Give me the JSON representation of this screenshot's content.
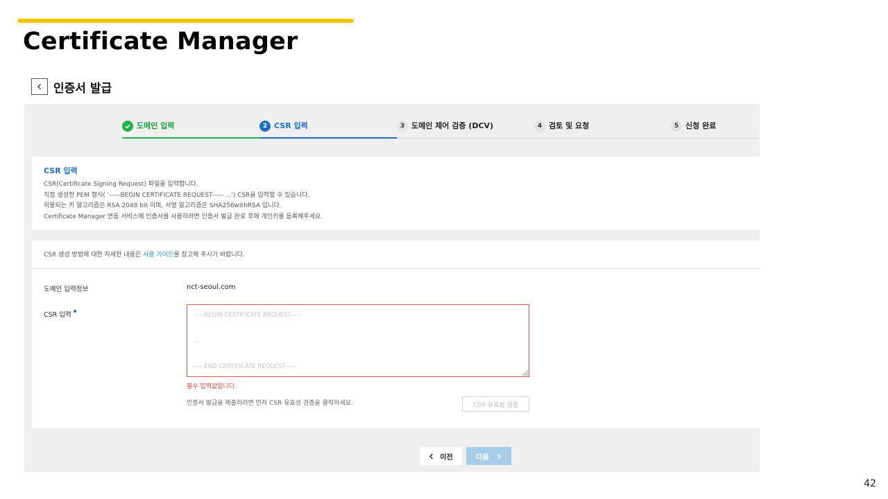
{
  "slide": {
    "title": "Certificate Manager",
    "page_number": "42",
    "accent_color": "#f5c400"
  },
  "header": {
    "back_icon": "chevron-left-icon",
    "title": "인증서 발급"
  },
  "stepper": {
    "steps": [
      {
        "number": "",
        "label": "도메인 입력",
        "state": "done",
        "icon": "check-icon"
      },
      {
        "number": "2",
        "label": "CSR 입력",
        "state": "active"
      },
      {
        "number": "3",
        "label": "도메인 제어 검증 (DCV)",
        "state": "pending"
      },
      {
        "number": "4",
        "label": "검토 및 요청",
        "state": "pending"
      },
      {
        "number": "5",
        "label": "신청 완료",
        "state": "pending"
      }
    ],
    "colors": {
      "done": "#21b24b",
      "active": "#1f6fbf"
    }
  },
  "info": {
    "title": "CSR 입력",
    "lines": [
      "CSR(Certificate Signing Request) 파일을 입력합니다.",
      "직접 생성한 PEM 형식( '-----BEGIN CERTIFICATE REQUEST----- ...') CSR을 입력할 수 있습니다.",
      "허용되는 키 알고리즘은 RSA 2048 bit 이며, 서명 알고리즘은 SHA256withRSA 입니다.",
      "Certificate Manager 연동 서비스에 인증서를 사용하려면 인증서 발급 완료 후에 개인키를 등록해주세요."
    ]
  },
  "form": {
    "guide_prefix": "CSR 생성 방법에 대한 자세한 내용은 ",
    "guide_link": "사용 가이드",
    "guide_suffix": "를 참고해 주시기 바랍니다.",
    "domain_label": "도메인 입력정보",
    "domain_value": "nct-seoul.com",
    "csr_label": "CSR 입력",
    "csr_placeholder": "-----BEGIN CERTIFICATE REQUEST-----\n\n...\n\n-----END CERTIFICATE REQUEST-----",
    "error_text": "필수 입력값입니다.",
    "helper_text": "인증서 발급을 제출하려면 먼저 CSR 유효성 검증을 클릭하세요.",
    "validate_button": "CSR 유효성 검증",
    "error_color": "#d9403a"
  },
  "footer": {
    "prev_label": "이전",
    "next_label": "다음"
  }
}
